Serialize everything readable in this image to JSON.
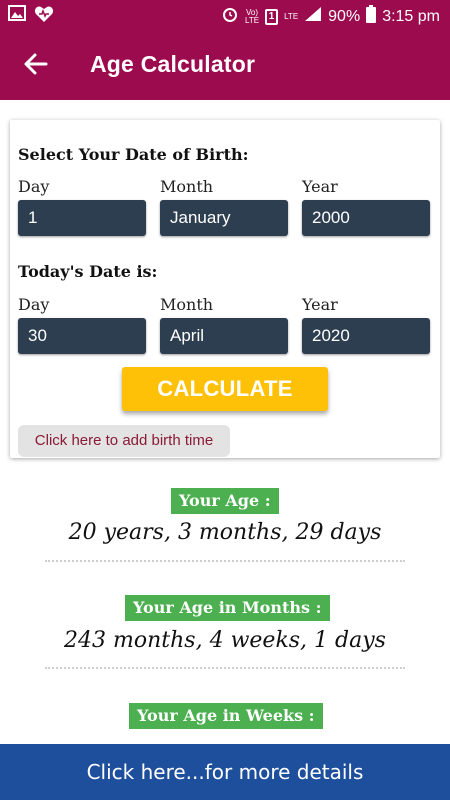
{
  "status_bar": {
    "lte_label": "LTE",
    "sim_label": "1",
    "battery": "90%",
    "time": "3:15 pm"
  },
  "app_bar": {
    "title": "Age Calculator"
  },
  "birth": {
    "heading": "Select Your Date of Birth:",
    "day_label": "Day",
    "month_label": "Month",
    "year_label": "Year",
    "day": "1",
    "month": "January",
    "year": "2000"
  },
  "today": {
    "heading": "Today's Date is:",
    "day_label": "Day",
    "month_label": "Month",
    "year_label": "Year",
    "day": "30",
    "month": "April",
    "year": "2020"
  },
  "calculate_label": "CALCULATE",
  "birth_time_link": "Click here to add birth time",
  "results": {
    "age_label": "Your Age :",
    "age_value": "20 years, 3 months, 29 days",
    "months_label": "Your Age in Months :",
    "months_value": "243 months, 4 weeks, 1 days",
    "weeks_label": "Your Age in Weeks :"
  },
  "more_details": "Click here...for more details",
  "colors": {
    "app_bar": "#9c0b4e",
    "field": "#2c3e50",
    "calculate": "#ffc107",
    "badge": "#4caf50",
    "bottom_bar": "#1e4f9c"
  }
}
